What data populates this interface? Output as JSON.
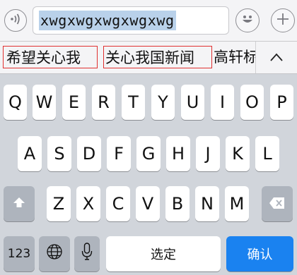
{
  "input_bar": {
    "composing_text": "xwgxwgxwgxwgxwg"
  },
  "candidates": [
    "希望关心我",
    "关心我国新闻",
    "高轩标"
  ],
  "keyboard": {
    "row1": [
      "Q",
      "W",
      "E",
      "R",
      "T",
      "Y",
      "U",
      "I",
      "O",
      "P"
    ],
    "row2": [
      "A",
      "S",
      "D",
      "F",
      "G",
      "H",
      "J",
      "K",
      "L"
    ],
    "row3": [
      "Z",
      "X",
      "C",
      "V",
      "B",
      "N",
      "M"
    ],
    "numbers_label": "123",
    "space_label": "选定",
    "confirm_label": "确认"
  },
  "icons": {
    "voice": "voice-wave-icon",
    "emoji": "emoji-icon",
    "add": "add-icon",
    "expand": "chevron-up-icon",
    "shift": "shift-icon",
    "delete": "delete-icon",
    "globe": "globe-icon",
    "mic": "microphone-icon"
  },
  "colors": {
    "confirm_key": "#1a82f0",
    "candidate_outline": "#e03030",
    "selection_highlight": "#b9d1ea"
  }
}
